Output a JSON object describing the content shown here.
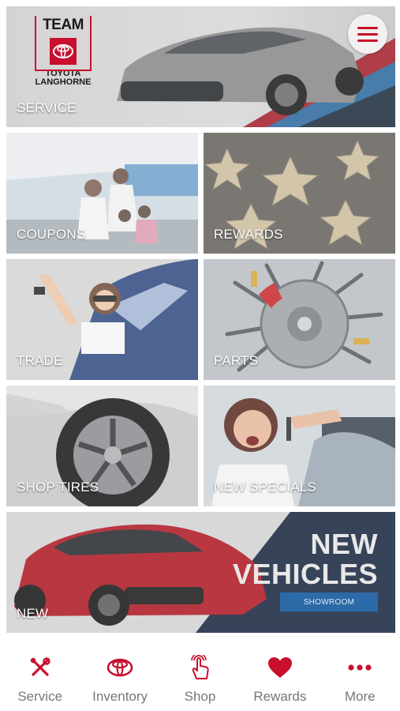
{
  "colors": {
    "accent": "#c8102e",
    "tab_label": "#777777",
    "tile_overlay": "rgba(255,255,255,0.35)"
  },
  "header": {
    "logo": {
      "team": "TEAM",
      "brand_line1": "TOYOTA",
      "brand_line2": "LANGHORNE",
      "icon": "toyota-logo-icon"
    },
    "menu_icon": "hamburger-menu-icon"
  },
  "tiles": {
    "service": "SERVICE",
    "coupons": "COUPONS",
    "rewards": "REWARDS",
    "trade": "TRADE",
    "parts": "PARTS",
    "shop_tires": "SHOP TIRES",
    "new_specials": "NEW SPECIALS",
    "new": "NEW"
  },
  "new_vehicles_banner": {
    "line1": "NEW",
    "line2": "VEHICLES",
    "button": "SHOWROOM"
  },
  "tabbar": {
    "items": [
      {
        "label": "Service",
        "icon": "wrench-screwdriver-icon"
      },
      {
        "label": "Inventory",
        "icon": "toyota-logo-icon"
      },
      {
        "label": "Shop",
        "icon": "tap-hand-icon"
      },
      {
        "label": "Rewards",
        "icon": "heart-icon"
      },
      {
        "label": "More",
        "icon": "more-dots-icon"
      }
    ]
  }
}
